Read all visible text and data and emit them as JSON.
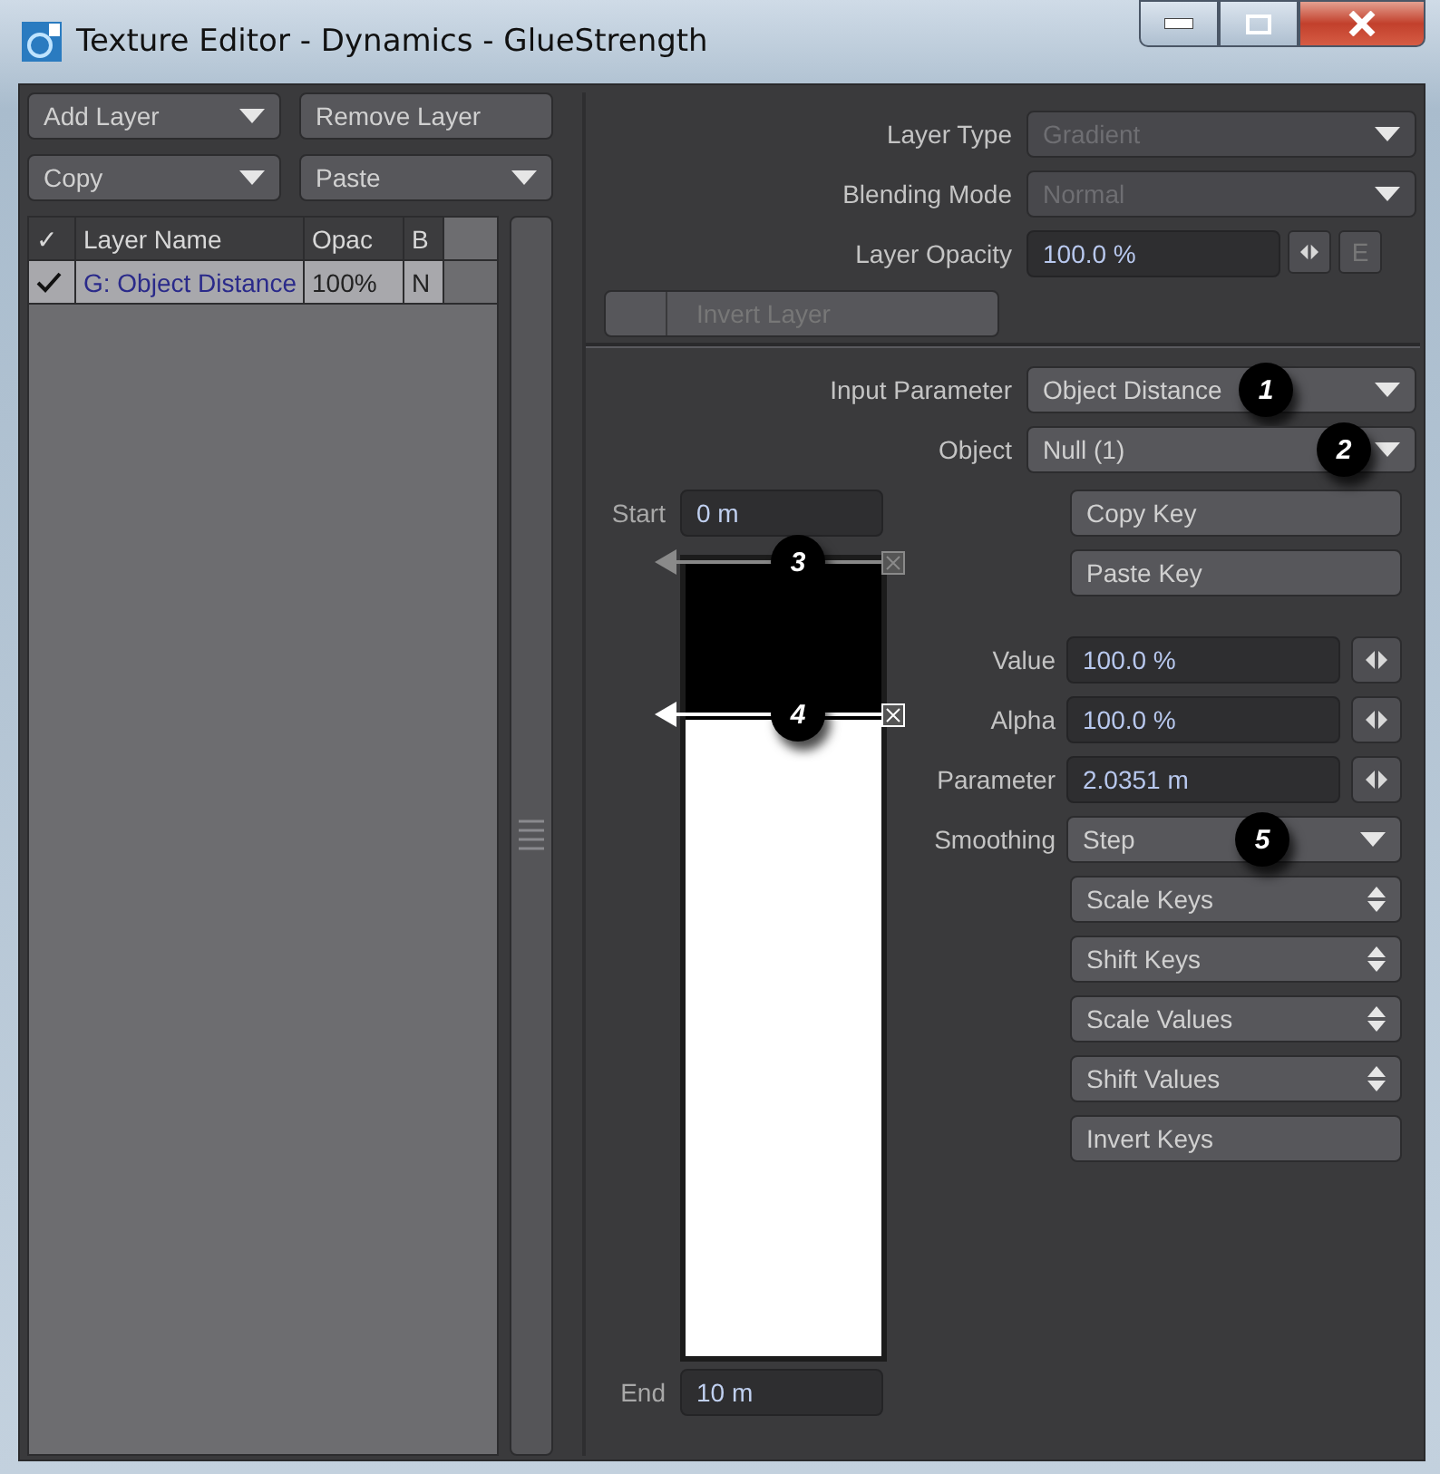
{
  "window": {
    "title": "Texture Editor - Dynamics - GlueStrength"
  },
  "layer_toolbar": [
    {
      "label": "Add Layer",
      "kind": "dropdown"
    },
    {
      "label": "Remove Layer",
      "kind": "button"
    },
    {
      "label": "Copy",
      "kind": "dropdown"
    },
    {
      "label": "Paste",
      "kind": "dropdown"
    }
  ],
  "layer_table": {
    "columns": [
      "✓",
      "Layer Name",
      "Opac",
      "B"
    ],
    "rows": [
      {
        "checked": true,
        "selected": true,
        "name": "G: Object Distance",
        "opacity": "100%",
        "blending": "N"
      }
    ]
  },
  "layer_settings": [
    {
      "label": "Layer Type",
      "value": "Gradient",
      "kind": "dropdown",
      "disabled": true
    },
    {
      "label": "Blending Mode",
      "value": "Normal",
      "kind": "dropdown",
      "disabled": true
    },
    {
      "label": "Layer Opacity",
      "value": "100.0 %",
      "kind": "envelope",
      "envelope": "E"
    }
  ],
  "invert_layer": {
    "label": "Invert Layer",
    "checked": false
  },
  "gradient_settings": [
    {
      "label": "Input Parameter",
      "value": "Object Distance",
      "kind": "dropdown",
      "callout": "1"
    },
    {
      "label": "Object",
      "value": "Null (1)",
      "kind": "dropdown",
      "callout": "2"
    }
  ],
  "start": {
    "label": "Start",
    "value": "0 m"
  },
  "end": {
    "label": "End",
    "value": "10 m"
  },
  "keys": [
    {
      "callout": "3",
      "selected": false
    },
    {
      "callout": "4",
      "selected": true
    }
  ],
  "key_buttons": [
    "Copy Key",
    "Paste Key"
  ],
  "key_fields": [
    {
      "label": "Value",
      "value": "100.0 %",
      "kind": "number"
    },
    {
      "label": "Alpha",
      "value": "100.0 %",
      "kind": "number"
    },
    {
      "label": "Parameter",
      "value": "2.0351 m",
      "kind": "number"
    },
    {
      "label": "Smoothing",
      "value": "Step",
      "kind": "dropdown",
      "callout": "5"
    }
  ],
  "key_tools": [
    {
      "label": "Scale Keys",
      "kind": "spinner"
    },
    {
      "label": "Shift Keys",
      "kind": "spinner"
    },
    {
      "label": "Scale Values",
      "kind": "spinner"
    },
    {
      "label": "Shift Values",
      "kind": "spinner"
    },
    {
      "label": "Invert Keys",
      "kind": "button"
    }
  ]
}
